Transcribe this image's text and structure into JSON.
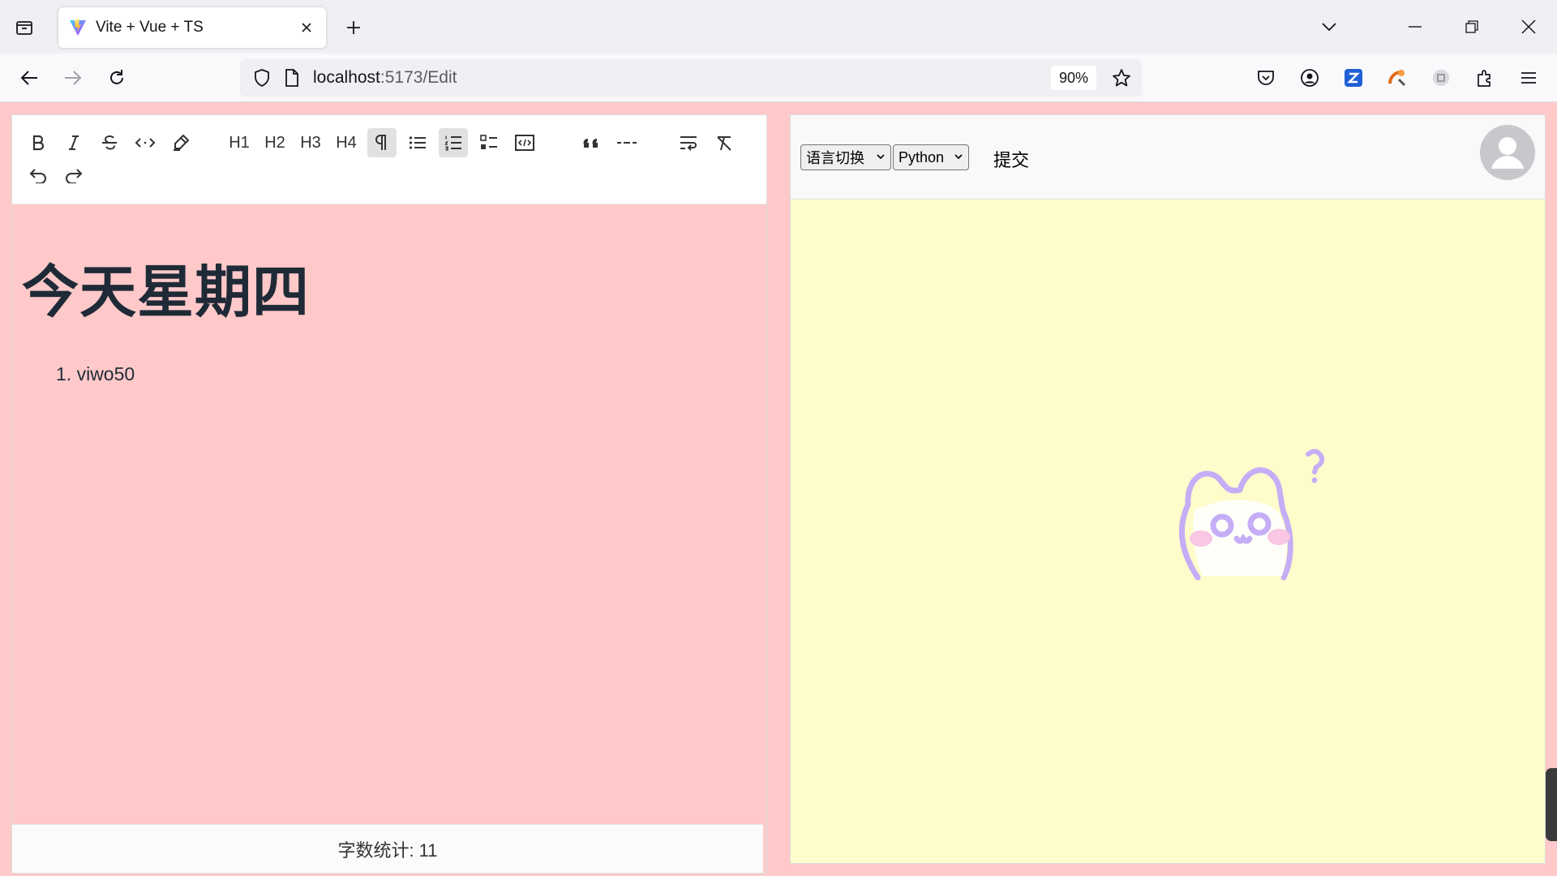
{
  "browser": {
    "tab_title": "Vite + Vue + TS",
    "url_host": "localhost",
    "url_path": ":5173/Edit",
    "zoom": "90%"
  },
  "editor": {
    "toolbar": {
      "h1": "H1",
      "h2": "H2",
      "h3": "H3",
      "h4": "H4"
    },
    "title": "今天星期四",
    "list_items": [
      "viwo50"
    ],
    "list_item_number": "1.",
    "word_count": "字数统计: 11"
  },
  "preview": {
    "language_select": "语言切换",
    "code_language_select": "Python",
    "submit_label": "提交"
  },
  "colors": {
    "page_bg": "#ffc9c9",
    "preview_bg": "#fffccb",
    "mascot": "#c5aef6"
  }
}
